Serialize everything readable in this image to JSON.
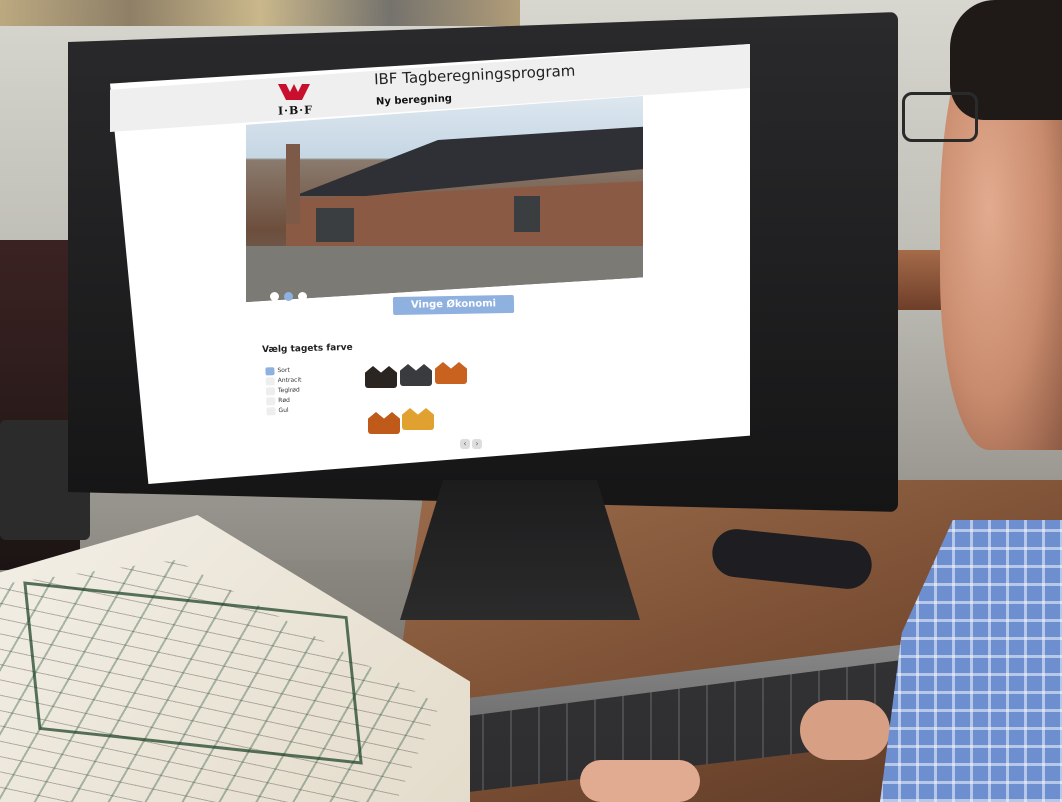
{
  "app": {
    "title": "IBF Tagberegningsprogram",
    "subtitle": "Ny beregning",
    "logo_text": "I·B·F"
  },
  "hero": {
    "product_button_label": "Vinge Økonomi",
    "slides": 3,
    "active_slide": 2
  },
  "color_picker": {
    "heading": "Vælg tagets farve",
    "options": [
      {
        "label": "Sort",
        "selected": true
      },
      {
        "label": "Antracit",
        "selected": false
      },
      {
        "label": "Teglrød",
        "selected": false
      },
      {
        "label": "Rød",
        "selected": false
      },
      {
        "label": "Gul",
        "selected": false
      }
    ],
    "tile_colors": [
      "#2b2522",
      "#3a3b3f",
      "#c8621e",
      "#c05a1b",
      "#e0a130"
    ]
  },
  "pager": {
    "prev_icon": "chevron-left-icon",
    "next_icon": "chevron-right-icon"
  },
  "colors": {
    "accent": "#8fb1e0",
    "header_bg": "#efefef"
  }
}
